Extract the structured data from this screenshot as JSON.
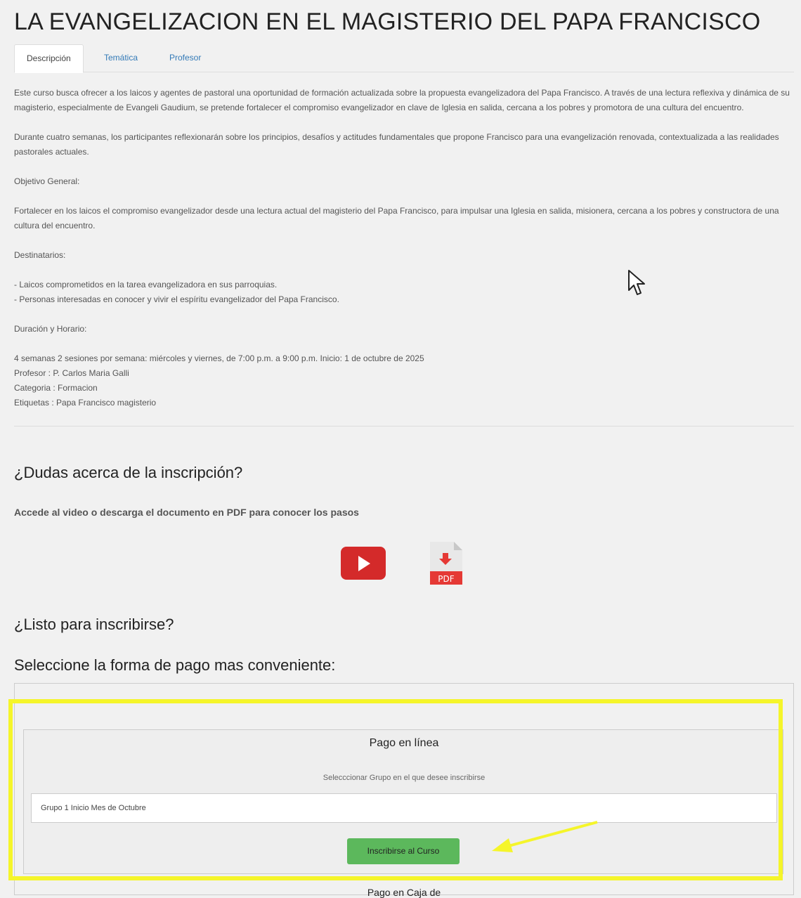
{
  "title": "LA EVANGELIZACION EN EL MAGISTERIO DEL PAPA FRANCISCO",
  "tabs": [
    {
      "label": "Descripción",
      "active": true
    },
    {
      "label": "Temática",
      "active": false
    },
    {
      "label": "Profesor",
      "active": false
    }
  ],
  "description": {
    "p1": "Este curso busca ofrecer a los laicos y agentes de pastoral una oportunidad de formación actualizada sobre la propuesta evangelizadora del Papa Francisco. A través de una lectura reflexiva y dinámica de su magisterio, especialmente de Evangeli Gaudium, se pretende fortalecer el compromiso evangelizador en clave de Iglesia en salida, cercana a los pobres y promotora de una cultura del encuentro.",
    "p2": "Durante cuatro semanas, los participantes reflexionarán sobre los principios, desafíos y actitudes fundamentales que propone Francisco para una evangelización renovada, contextualizada a las realidades pastorales actuales.",
    "objetivo_label": "Objetivo General:",
    "objetivo": "Fortalecer en los laicos el compromiso evangelizador desde una lectura actual del magisterio del Papa Francisco, para impulsar una Iglesia en salida, misionera, cercana a los pobres y constructora de una cultura del encuentro.",
    "destinatarios_label": "Destinatarios:",
    "destinatarios": [
      "- Laicos comprometidos en la tarea evangelizadora en sus parroquias.",
      "- Personas interesadas en conocer y vivir el espíritu evangelizador del Papa Francisco."
    ],
    "duracion_label": "Duración y Horario:",
    "duracion": "4 semanas 2 sesiones por semana: miércoles y viernes, de 7:00 p.m. a 9:00 p.m. Inicio: 1 de octubre de 2025",
    "profesor": "Profesor : P. Carlos Maria Galli",
    "categoria": "Categoria : Formacion",
    "etiquetas": "Etiquetas : Papa Francisco magisterio"
  },
  "dudas": {
    "heading": "¿Dudas acerca de la inscripción?",
    "subtext": "Accede al video o descarga el documento en PDF para conocer los pasos",
    "pdf_label": "PDF"
  },
  "listo_heading": "¿Listo para inscribirse?",
  "pago_heading": "Seleccione la forma de pago mas conveniente:",
  "pago_linea": {
    "title": "Pago en línea",
    "subtitle": "Selecccionar Grupo en el que desee inscribirse",
    "group_value": "Grupo 1 Inicio Mes de Octubre",
    "button": "Inscribirse al Curso"
  },
  "bottom_cut_text": "Pago en Caja de",
  "colors": {
    "youtube_red": "#d42a2a",
    "pdf_red": "#e53935",
    "button_green": "#5cb85c",
    "highlight_yellow": "#f5f52a",
    "tab_link_blue": "#337ab7"
  }
}
